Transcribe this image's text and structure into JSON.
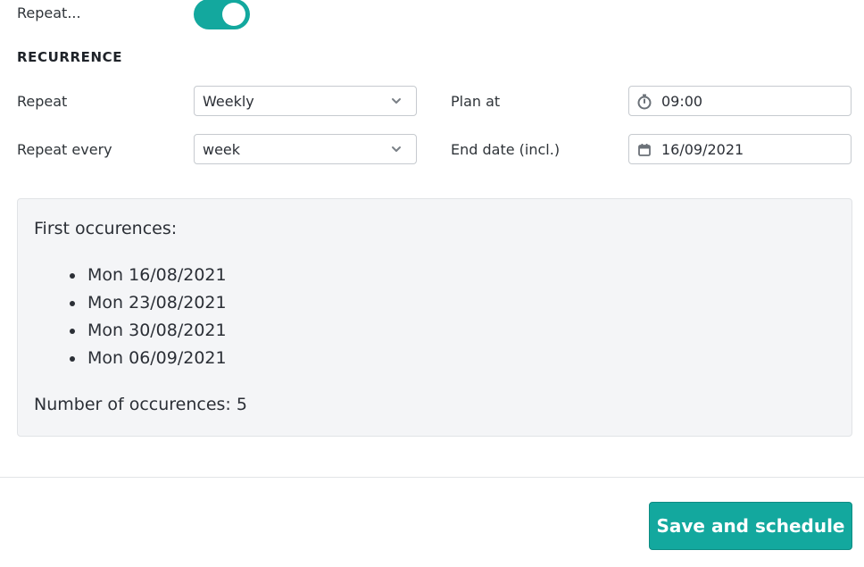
{
  "repeat_toggle": {
    "label": "Repeat...",
    "on": true,
    "color": "#13a89e"
  },
  "recurrence": {
    "section_title": "RECURRENCE",
    "repeat": {
      "label": "Repeat",
      "value": "Weekly"
    },
    "repeat_every": {
      "label": "Repeat every",
      "value": "week"
    },
    "plan_at": {
      "label": "Plan at",
      "value": "09:00",
      "icon": "stopwatch-icon"
    },
    "end_date": {
      "label": "End date (incl.)",
      "value": "16/09/2021",
      "icon": "calendar-icon"
    }
  },
  "occurrences_panel": {
    "heading": "First occurences:",
    "items": [
      "Mon 16/08/2021",
      "Mon 23/08/2021",
      "Mon 30/08/2021",
      "Mon 06/09/2021"
    ],
    "count_text": "Number of occurences: 5"
  },
  "footer": {
    "save_label": "Save and schedule",
    "accent": "#13a89e"
  }
}
